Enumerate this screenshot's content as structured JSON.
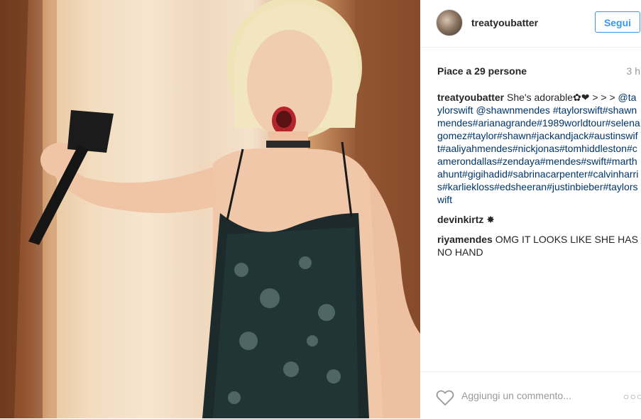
{
  "post": {
    "header": {
      "username": "treatyoubatter",
      "follow_label": "Segui"
    },
    "likes_text": "Piace a 29 persone",
    "time_ago": "3 h",
    "comments": [
      {
        "user": "treatyoubatter",
        "text": "She's adorable✿❤︎ > > >",
        "tags": "@taylorswift @shawnmendes #taylorswift#shawnmendes#arianagrande#1989worldtour#selenagomez#taylor#shawn#jackandjack#austinswift#aaliyahmendes#nickjonas#tomhiddleston#camerondallas#zendaya#mendes#swift#marthahunt#gigihadid#sabrinacarpenter#calvinharris#karliekloss#edsheeran#justinbieber#taylorswift"
      },
      {
        "user": "devinkirtz",
        "text": "✸"
      },
      {
        "user": "riyamendes",
        "text": "OMG IT LOOKS LIKE SHE HAS NO HAND"
      }
    ],
    "add_comment_placeholder": "Aggiungi un commento...",
    "more_label": "○○○",
    "icons": {
      "heart": "heart-outline-icon",
      "more": "more-options-icon"
    },
    "colors": {
      "link": "#003569",
      "button": "#3897f0",
      "muted": "#999999"
    }
  }
}
